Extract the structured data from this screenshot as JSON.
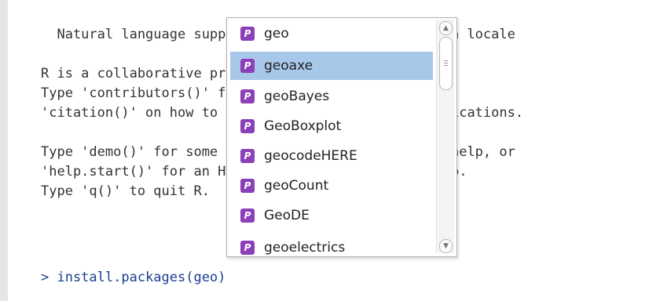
{
  "console": {
    "lines": [
      "  Natural language support but running in an English locale",
      "",
      "R is a collaborative project with many contributors.",
      "Type 'contributors()' for more information and",
      "'citation()' on how to cite R or R packages in publications.",
      "",
      "Type 'demo()' for some demos, 'help()' for on-line help, or",
      "'help.start()' for an HTML browser interface to help.",
      "Type 'q()' to quit R."
    ],
    "prompt": "> install.packages(geo)"
  },
  "autocomplete": {
    "badge": "P",
    "icon": "package-icon",
    "selected_index": 1,
    "items": [
      "geo",
      "geoaxe",
      "geoBayes",
      "GeoBoxplot",
      "geocodeHERE",
      "geoCount",
      "GeoDE",
      "geoelectrics"
    ]
  },
  "colors": {
    "badge": "#8b3fb8",
    "selection": "#a8c8ea",
    "prompt": "#1a3f8e"
  }
}
